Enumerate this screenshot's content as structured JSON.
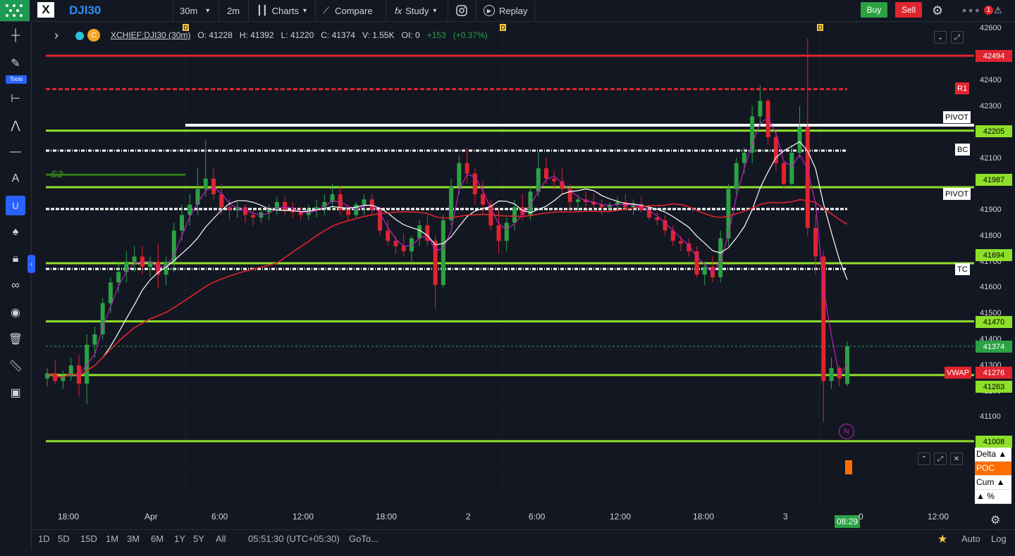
{
  "toolbar": {
    "symbol": "DJI30",
    "interval": "30m",
    "interval2": "2m",
    "charts_label": "Charts",
    "compare_label": "Compare",
    "study_label": "Study",
    "replay_label": "Replay",
    "buy_label": "Buy",
    "sell_label": "Sell",
    "notif_count": "1",
    "more_label": "∘∘∘"
  },
  "legend": {
    "name": "XCHIEF:DJI30 (30m)",
    "o_label": "O:",
    "o": "41228",
    "h_label": "H:",
    "h": "41392",
    "l_label": "L:",
    "l": "41220",
    "c_label": "C:",
    "c": "41374",
    "v_label": "V:",
    "v": "1.55K",
    "oi_label": "OI:",
    "oi": "0",
    "change": "+153",
    "change_pct": "(+0.37%)"
  },
  "left_tools": {
    "tools_label": "Tools"
  },
  "price_axis": {
    "labels": [
      "42600",
      "42400",
      "42300",
      "42100",
      "41900",
      "41800",
      "41700",
      "41600",
      "41500",
      "41400",
      "41300",
      "41200",
      "41100"
    ],
    "tags": {
      "t42494": "42494",
      "t42205": "42205",
      "t41987": "41987",
      "t41694": "41694",
      "t41470": "41470",
      "t41374": "41374",
      "t41276": "41276",
      "t41263": "41263",
      "t41008": "41008"
    }
  },
  "level_labels": {
    "r1": "R1",
    "pivot1": "PIVOT",
    "bc": "BC",
    "pivot2": "PIVOT",
    "tc": "TC",
    "vwap": "VWAP",
    "s2": "S2",
    "news": "N"
  },
  "indicator_panel": {
    "delta": "Delta ▲",
    "poc": "POC",
    "cum": "Cum ▲",
    "pct": "▲ %"
  },
  "time_axis": {
    "labels": [
      "18:00",
      "Apr",
      "6:00",
      "12:00",
      "18:00",
      "2",
      "6:00",
      "12:00",
      "18:00",
      "3",
      "12:00"
    ],
    "cursor_time": "08:29",
    "cursor_tail": "0"
  },
  "bottom_bar": {
    "ranges": [
      "1D",
      "5D",
      "15D",
      "1M",
      "3M",
      "6M",
      "1Y",
      "5Y",
      "All"
    ],
    "clock": "05:51:30 (UTC+05:30)",
    "goto": "GoTo...",
    "auto": "Auto",
    "log": "Log"
  },
  "colors": {
    "bull": "#2ba244",
    "bear": "#e0242f",
    "level_green": "#8ee02a",
    "level_red": "#e0242f",
    "accent": "#2962ff"
  },
  "chart_data": {
    "type": "candlestick",
    "ylim": [
      41000,
      42620
    ],
    "time_labels": [
      "18:00",
      "Apr",
      "6:00",
      "12:00",
      "18:00",
      "2",
      "6:00",
      "12:00",
      "18:00",
      "3",
      "12:00"
    ],
    "candles": [
      [
        41250,
        41290,
        41220,
        41270
      ],
      [
        41270,
        41320,
        41230,
        41240
      ],
      [
        41240,
        41280,
        41210,
        41260
      ],
      [
        41260,
        41330,
        41240,
        41300
      ],
      [
        41300,
        41340,
        41180,
        41230
      ],
      [
        41230,
        41420,
        41150,
        41380
      ],
      [
        41380,
        41450,
        41330,
        41420
      ],
      [
        41420,
        41560,
        41400,
        41540
      ],
      [
        41540,
        41640,
        41500,
        41620
      ],
      [
        41620,
        41700,
        41580,
        41660
      ],
      [
        41660,
        41740,
        41620,
        41700
      ],
      [
        41700,
        41760,
        41660,
        41720
      ],
      [
        41720,
        41760,
        41650,
        41680
      ],
      [
        41680,
        41720,
        41640,
        41700
      ],
      [
        41700,
        41770,
        41600,
        41650
      ],
      [
        41650,
        41720,
        41610,
        41700
      ],
      [
        41700,
        41850,
        41660,
        41820
      ],
      [
        41820,
        41920,
        41780,
        41880
      ],
      [
        41880,
        41960,
        41840,
        41920
      ],
      [
        41920,
        42060,
        41880,
        41980
      ],
      [
        41980,
        42170,
        41950,
        42020
      ],
      [
        42020,
        42060,
        41940,
        41960
      ],
      [
        41960,
        42000,
        41880,
        41910
      ],
      [
        41910,
        41940,
        41860,
        41900
      ],
      [
        41900,
        41930,
        41870,
        41910
      ],
      [
        41910,
        41920,
        41850,
        41880
      ],
      [
        41880,
        41900,
        41840,
        41870
      ],
      [
        41870,
        41910,
        41850,
        41890
      ],
      [
        41890,
        41920,
        41860,
        41900
      ],
      [
        41900,
        41950,
        41880,
        41930
      ],
      [
        41930,
        41950,
        41880,
        41900
      ],
      [
        41900,
        41930,
        41870,
        41890
      ],
      [
        41890,
        41910,
        41860,
        41880
      ],
      [
        41880,
        41920,
        41860,
        41900
      ],
      [
        41900,
        41940,
        41870,
        41910
      ],
      [
        41910,
        41960,
        41880,
        41930
      ],
      [
        41930,
        42000,
        41900,
        41960
      ],
      [
        41960,
        41990,
        41880,
        41900
      ],
      [
        41900,
        41920,
        41860,
        41880
      ],
      [
        41880,
        41930,
        41870,
        41920
      ],
      [
        41920,
        41960,
        41880,
        41940
      ],
      [
        41940,
        41960,
        41880,
        41900
      ],
      [
        41900,
        41910,
        41800,
        41820
      ],
      [
        41820,
        41860,
        41760,
        41780
      ],
      [
        41780,
        41800,
        41730,
        41760
      ],
      [
        41760,
        41810,
        41720,
        41740
      ],
      [
        41740,
        41800,
        41700,
        41790
      ],
      [
        41790,
        41860,
        41760,
        41840
      ],
      [
        41840,
        41880,
        41760,
        41780
      ],
      [
        41780,
        41800,
        41520,
        41610
      ],
      [
        41610,
        41880,
        41600,
        41860
      ],
      [
        41860,
        42020,
        41840,
        41990
      ],
      [
        41990,
        42110,
        41960,
        42080
      ],
      [
        42080,
        42140,
        42000,
        42040
      ],
      [
        42040,
        42060,
        41920,
        41960
      ],
      [
        41960,
        42010,
        41880,
        41920
      ],
      [
        41920,
        41940,
        41820,
        41840
      ],
      [
        41840,
        41900,
        41730,
        41780
      ],
      [
        41780,
        41870,
        41740,
        41850
      ],
      [
        41850,
        41940,
        41820,
        41910
      ],
      [
        41910,
        41960,
        41860,
        41880
      ],
      [
        41880,
        41990,
        41860,
        41970
      ],
      [
        41970,
        42120,
        41950,
        42060
      ],
      [
        42060,
        42100,
        42000,
        42020
      ],
      [
        42020,
        42050,
        41980,
        42010
      ],
      [
        42010,
        42060,
        41960,
        41980
      ],
      [
        41980,
        42000,
        41900,
        41930
      ],
      [
        41930,
        41960,
        41890,
        41940
      ],
      [
        41940,
        41970,
        41910,
        41930
      ],
      [
        41930,
        41960,
        41900,
        41920
      ],
      [
        41920,
        41940,
        41880,
        41910
      ],
      [
        41910,
        41930,
        41890,
        41920
      ],
      [
        41920,
        41950,
        41900,
        41930
      ],
      [
        41930,
        41960,
        41900,
        41910
      ],
      [
        41910,
        41940,
        41880,
        41920
      ],
      [
        41920,
        41950,
        41890,
        41900
      ],
      [
        41900,
        41920,
        41860,
        41870
      ],
      [
        41870,
        41890,
        41840,
        41860
      ],
      [
        41860,
        41880,
        41800,
        41820
      ],
      [
        41820,
        41840,
        41760,
        41780
      ],
      [
        41780,
        41800,
        41740,
        41770
      ],
      [
        41770,
        41790,
        41720,
        41740
      ],
      [
        41740,
        41760,
        41640,
        41650
      ],
      [
        41650,
        41700,
        41610,
        41680
      ],
      [
        41680,
        41720,
        41620,
        41640
      ],
      [
        41640,
        41820,
        41620,
        41790
      ],
      [
        41790,
        42000,
        41760,
        41980
      ],
      [
        41980,
        42100,
        41960,
        42080
      ],
      [
        42080,
        42140,
        42040,
        42120
      ],
      [
        42120,
        42300,
        42080,
        42260
      ],
      [
        42260,
        42380,
        42220,
        42320
      ],
      [
        42320,
        42330,
        42150,
        42180
      ],
      [
        42180,
        42200,
        42050,
        42080
      ],
      [
        42080,
        42090,
        41980,
        42000
      ],
      [
        42000,
        42150,
        41980,
        42120
      ],
      [
        42120,
        42300,
        42100,
        42220
      ],
      [
        42220,
        42560,
        41800,
        41830
      ],
      [
        41830,
        41880,
        41650,
        41720
      ],
      [
        41720,
        41740,
        41080,
        41240
      ],
      [
        41240,
        41330,
        41210,
        41290
      ],
      [
        41290,
        41300,
        41220,
        41250
      ],
      [
        41228,
        41392,
        41220,
        41374
      ]
    ]
  }
}
